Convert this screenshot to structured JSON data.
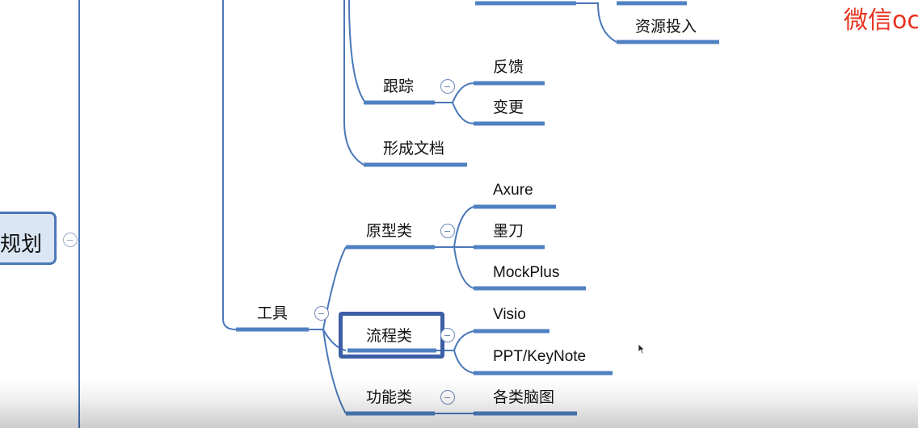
{
  "watermark": {
    "text": "微信oc"
  },
  "root": {
    "label": "规划"
  },
  "nodes": {
    "ziyuan": "资源投入",
    "genzong": "跟踪",
    "fankui": "反馈",
    "biangeng": "变更",
    "xingcheng": "形成文档",
    "gongju": "工具",
    "yuanxing": "原型类",
    "axure": "Axure",
    "modao": "墨刀",
    "mockplus": "MockPlus",
    "liucheng": "流程类",
    "visio": "Visio",
    "ppt": "PPT/KeyNote",
    "gongneng": "功能类",
    "naotu": "各类脑图"
  },
  "colors": {
    "branch": "#4a78b8",
    "underline": "#4f80c2",
    "selection": "#3c5fa6",
    "watermark": "#e8321f"
  }
}
